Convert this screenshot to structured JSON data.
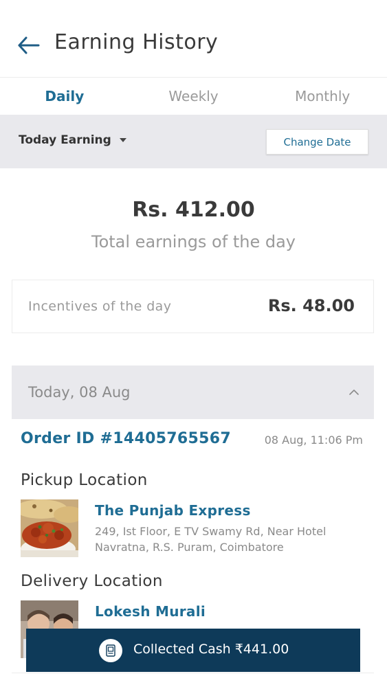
{
  "header": {
    "title": "Earning History",
    "back_icon": "arrow-left-icon"
  },
  "tabs": [
    {
      "label": "Daily",
      "active": true
    },
    {
      "label": "Weekly",
      "active": false
    },
    {
      "label": "Monthly",
      "active": false
    }
  ],
  "filter": {
    "selected": "Today Earning",
    "change_date_label": "Change Date"
  },
  "summary": {
    "total_amount": "Rs. 412.00",
    "total_caption": "Total earnings of the day",
    "incentive_label": "Incentives of the day",
    "incentive_amount": "Rs. 48.00"
  },
  "day_group": {
    "label": "Today, 08 Aug",
    "expanded": true
  },
  "order": {
    "id_label": "Order ID #14405765567",
    "time": "08 Aug, 11:06 Pm",
    "pickup": {
      "section_label": "Pickup Location",
      "name": "The Punjab Express",
      "address_line1": "249, Ist Floor, E TV Swamy Rd, Near Hotel",
      "address_line2": "Navratna, R.S. Puram, Coimbatore"
    },
    "delivery": {
      "section_label": "Delivery Location",
      "name": "Lokesh Murali"
    }
  },
  "collected_button": {
    "label": "Collected Cash ₹441.00",
    "icon": "cash-icon"
  },
  "colors": {
    "accent": "#1f6d94",
    "primary_dark": "#0e3a59",
    "band_gray": "#e9e9ed"
  }
}
